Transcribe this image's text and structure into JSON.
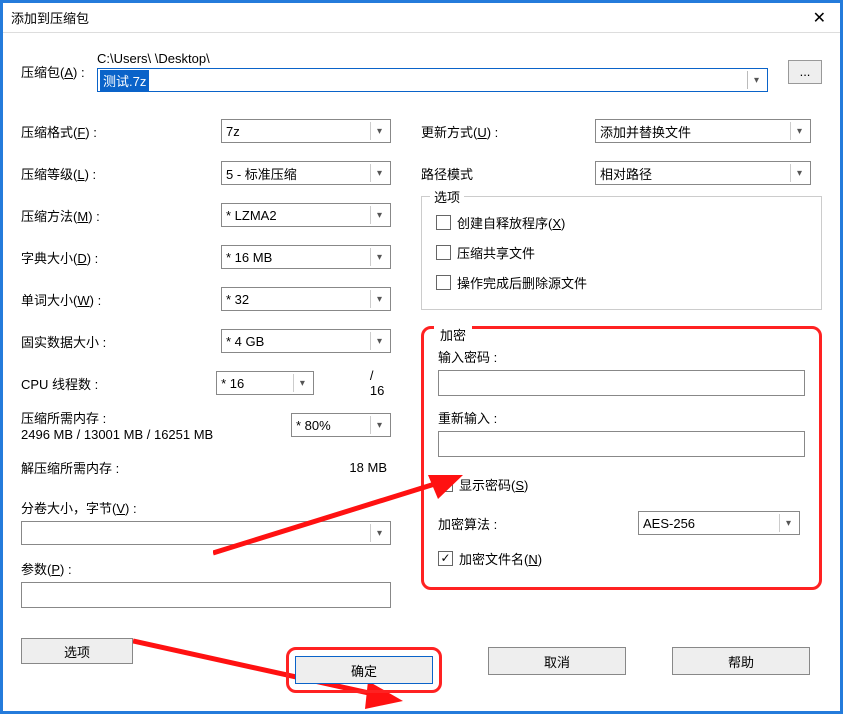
{
  "title": "添加到压缩包",
  "archive": {
    "label": "压缩包(A) :",
    "path": "C:\\Users\\            \\Desktop\\",
    "value": "测试.7z"
  },
  "left": {
    "format": {
      "label": "压缩格式(F) :",
      "value": "7z"
    },
    "level": {
      "label": "压缩等级(L) :",
      "value": "5 - 标准压缩"
    },
    "method": {
      "label": "压缩方法(M) :",
      "value": "* LZMA2"
    },
    "dict": {
      "label": "字典大小(D) :",
      "value": "* 16 MB"
    },
    "word": {
      "label": "单词大小(W) :",
      "value": "* 32"
    },
    "solid": {
      "label": "固实数据大小 :",
      "value": "* 4 GB"
    },
    "cpu": {
      "label": "CPU 线程数 :",
      "value": "* 16",
      "total": "/ 16"
    },
    "mem_compress": {
      "label": "压缩所需内存 :",
      "sub": "2496 MB / 13001 MB / 16251 MB",
      "value": "* 80%"
    },
    "mem_decompress": {
      "label": "解压缩所需内存 :",
      "value": "18 MB"
    },
    "split": {
      "label": "分卷大小，字节(V) :"
    },
    "params": {
      "label": "参数(P) :"
    },
    "options_btn": "选项"
  },
  "right": {
    "update": {
      "label": "更新方式(U) :",
      "value": "添加并替换文件"
    },
    "path_mode": {
      "label": "路径模式",
      "value": "相对路径"
    },
    "options": {
      "legend": "选项",
      "sfx": "创建自释放程序(X)",
      "shared": "压缩共享文件",
      "delete_after": "操作完成后删除源文件"
    },
    "encrypt": {
      "legend": "加密",
      "pw": "输入密码 :",
      "pw2": "重新输入 :",
      "show": "显示密码(S)",
      "algo_label": "加密算法 :",
      "algo_value": "AES-256",
      "enc_names": "加密文件名(N)"
    }
  },
  "buttons": {
    "ok": "确定",
    "cancel": "取消",
    "help": "帮助"
  },
  "browse": "..."
}
